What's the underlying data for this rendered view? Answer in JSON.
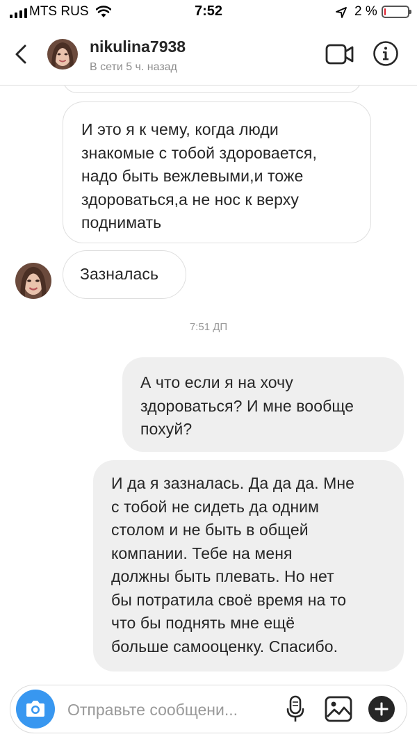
{
  "status_bar": {
    "carrier": "MTS RUS",
    "time": "7:52",
    "battery_percent": "2 %",
    "battery_level": 0.02
  },
  "header": {
    "username": "nikulina7938",
    "last_seen": "В сети 5 ч. назад",
    "icons": [
      "back-icon",
      "avatar",
      "video-camera-icon",
      "info-icon"
    ]
  },
  "messages": [
    {
      "direction": "incoming",
      "text": "И это я к чему, когда люди\nзнакомые с тобой здоровается,\nнадо быть вежлевыми,и тоже\nздороваться,а не нос к верху\nподнимать"
    },
    {
      "direction": "incoming",
      "text": "Зазналась"
    },
    {
      "direction": "outgoing",
      "text": "А что если я на хочу\nздороваться? И мне вообще\nпохуй?"
    },
    {
      "direction": "outgoing",
      "text": "И да я зазналась. Да да да. Мне\nс тобой не сидеть да одним\nстолом и не быть в общей\nкомпании. Тебе на меня\nдолжны быть плевать. Но нет\nбы потратила своё время на то\nчто бы поднять мне ещё\nбольше самооценку. Спасибо."
    }
  ],
  "timestamp": "7:51 ДП",
  "composer": {
    "placeholder": "Отправьте сообщени...",
    "value": ""
  },
  "colors": {
    "accent": "#3897f0",
    "outgoing_bubble": "#efefef",
    "incoming_border": "#dfdfdf",
    "secondary_text": "#8e8e8e"
  }
}
